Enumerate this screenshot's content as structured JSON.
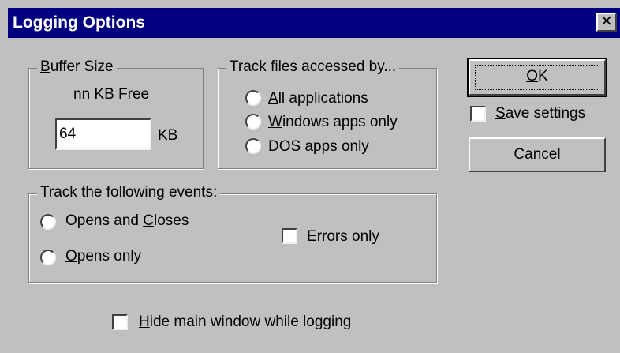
{
  "window": {
    "title": "Logging Options"
  },
  "buffer": {
    "legend_first": "B",
    "legend_rest": "uffer Size",
    "free_text": "nn KB Free",
    "value": "64",
    "unit": "KB"
  },
  "track_files": {
    "legend": "Track files accessed by...",
    "options": [
      {
        "u": "A",
        "rest": "ll applications"
      },
      {
        "u": "W",
        "rest": "indows apps only"
      },
      {
        "u": "D",
        "rest": "OS apps only"
      }
    ]
  },
  "events": {
    "legend": "Track the following events:",
    "opens_closes": {
      "pre": "Opens and ",
      "u": "C",
      "rest": "loses"
    },
    "opens_only": {
      "u": "O",
      "rest": "pens only"
    },
    "errors_only": {
      "u": "E",
      "rest": "rrors only"
    }
  },
  "buttons": {
    "ok": {
      "u": "O",
      "rest": "K"
    },
    "cancel": "Cancel"
  },
  "save_settings": {
    "u": "S",
    "rest": "ave settings"
  },
  "hide_window": {
    "u": "H",
    "rest": "ide main window while logging"
  }
}
